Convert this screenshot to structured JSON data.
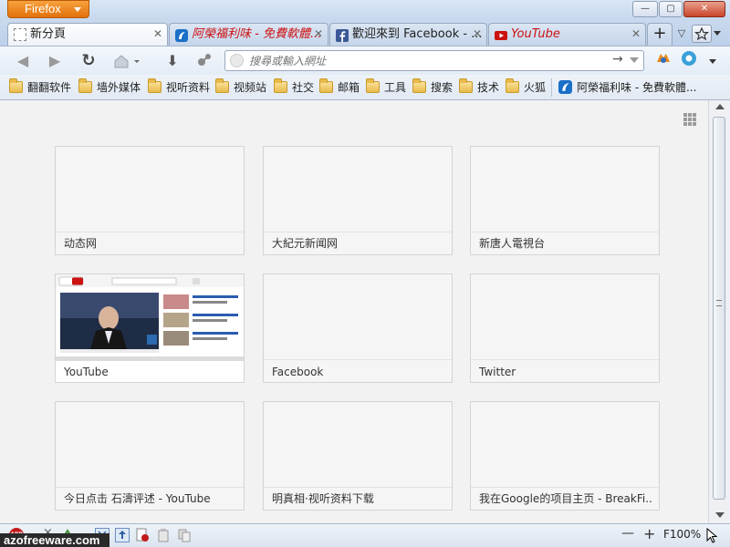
{
  "window": {
    "app_button_label": "Firefox",
    "controls": {
      "minimize": "—",
      "maximize": "▢",
      "close": "✕"
    }
  },
  "tabs": [
    {
      "title": "新分頁",
      "selected": true,
      "close": "✕"
    },
    {
      "title": "阿榮福利味 - 免費軟體...",
      "close": "✕"
    },
    {
      "title": "歡迎來到 Facebook - ...",
      "close": "✕"
    },
    {
      "title": "YouTube",
      "close": "✕"
    }
  ],
  "tabbar": {
    "new_tab": "+",
    "list_tabs": "▽"
  },
  "navbar": {
    "back": "◀",
    "forward": "▶",
    "reload": "↻",
    "download": "⬇",
    "url_placeholder": "搜尋或輸入網址",
    "go": "→"
  },
  "bookmarks": [
    {
      "label": "翻翻软件"
    },
    {
      "label": "墙外媒体"
    },
    {
      "label": "视听资料"
    },
    {
      "label": "视频站"
    },
    {
      "label": "社交"
    },
    {
      "label": "邮箱"
    },
    {
      "label": "工具"
    },
    {
      "label": "搜索"
    },
    {
      "label": "技术"
    },
    {
      "label": "火狐"
    },
    {
      "label": "阿榮福利味 - 免費軟體..."
    }
  ],
  "newtab_tiles": [
    {
      "label": "动态网"
    },
    {
      "label": "大紀元新闻网"
    },
    {
      "label": "新唐人電視台"
    },
    {
      "label": "YouTube",
      "has_thumbnail": true
    },
    {
      "label": "Facebook"
    },
    {
      "label": "Twitter"
    },
    {
      "label": "今日点击 石濤评述 - YouTube"
    },
    {
      "label": "明真相·视听资料下载"
    },
    {
      "label": "我在Google的项目主页 - BreakFi..."
    }
  ],
  "statusbar": {
    "abp": "ABP",
    "zoom_out": "—",
    "zoom_in": "+",
    "zoom_level": "F100%"
  },
  "watermark": "azofreeware.com",
  "colors": {
    "firefox_orange": "#e87d1a",
    "youtube_red": "#cc1111",
    "facebook_blue": "#3b5998",
    "tile_bg": "#f5f5f5",
    "content_bg": "#f2f2f2"
  }
}
